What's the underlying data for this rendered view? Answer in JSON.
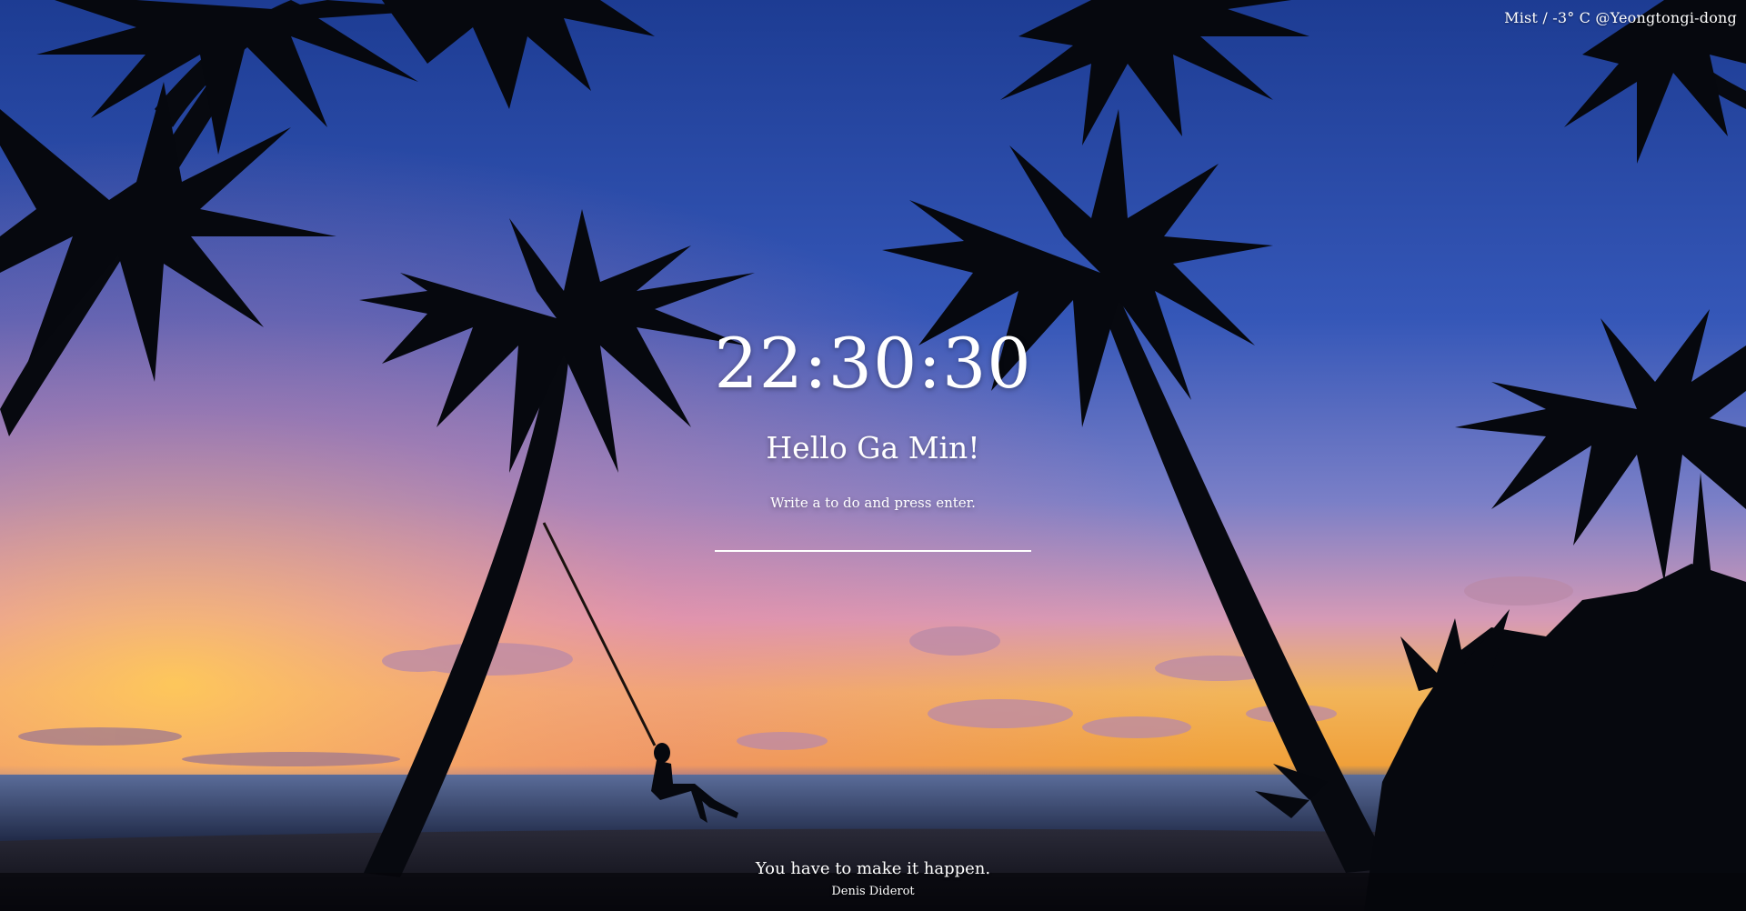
{
  "background": {
    "sky_top": "#1a3a8f",
    "sky_mid": "#3b5fc4",
    "horizon_glow": "#ffb23a",
    "sea": "#2c3f6a",
    "silhouette": "#0a0e1a"
  },
  "weather": {
    "text": "Mist / -3° C @Yeongtongi-dong"
  },
  "clock": {
    "time": "22:30:30"
  },
  "greeting": {
    "text": "Hello Ga Min!"
  },
  "todo": {
    "hint": "Write a to do and press enter.",
    "value": "",
    "placeholder": ""
  },
  "quote": {
    "text": "You have to make it happen.",
    "author": "Denis Diderot"
  }
}
